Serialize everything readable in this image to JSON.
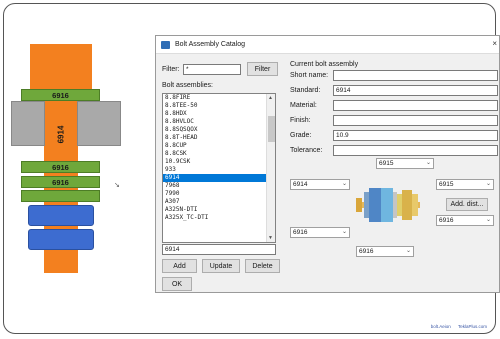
{
  "illustration": {
    "bolt_label": "6914",
    "washer_top": "6916",
    "washer_mid1": "6916",
    "washer_mid2": "6916",
    "cursor_glyph": "↘"
  },
  "dialog": {
    "title": "Bolt Assembly Catalog",
    "close_glyph": "×",
    "filter_label": "Filter:",
    "filter_value": "*",
    "filter_button": "Filter",
    "list_label": "Bolt assemblies:",
    "list_items": [
      "8.8FIRE",
      "8.8TEE-50",
      "8.8HDX",
      "8.8HVLOC",
      "8.8SQSQOX",
      "8.8T-HEAD",
      "8.8CUP",
      "8.8CSK",
      "10.9CSK",
      "933",
      "6914",
      "7968",
      "7990",
      "A307",
      "A325N-DTI",
      "A325X_TC-DTI"
    ],
    "selected_item": "6914",
    "name_field_value": "6914",
    "add_button": "Add",
    "update_button": "Update",
    "delete_button": "Delete",
    "ok_button": "OK",
    "current_label": "Current bolt assembly",
    "short_name_label": "Short name:",
    "short_name_value": "",
    "standard_label": "Standard:",
    "standard_value": "6914",
    "material_label": "Material:",
    "material_value": "",
    "finish_label": "Finish:",
    "finish_value": "",
    "grade_label": "Grade:",
    "grade_value": "10.9",
    "tolerance_label": "Tolerance:",
    "tolerance_value": "",
    "combo_top": "6915",
    "combo_left_top": "6914",
    "combo_left_bottom": "6916",
    "combo_right_top": "6915",
    "combo_right_bottom": "6916",
    "combo_bottom": "6916",
    "add_dist_button": "Add. dist..."
  },
  "footer": {
    "left": "bolt.Aeion",
    "right": "TeklaPlus.com"
  },
  "colors": {
    "bolt": "#f3801f",
    "washer": "#6fa83b",
    "nut": "#3d6cd0",
    "plate": "#a9a9a9",
    "selection": "#0078d7"
  }
}
